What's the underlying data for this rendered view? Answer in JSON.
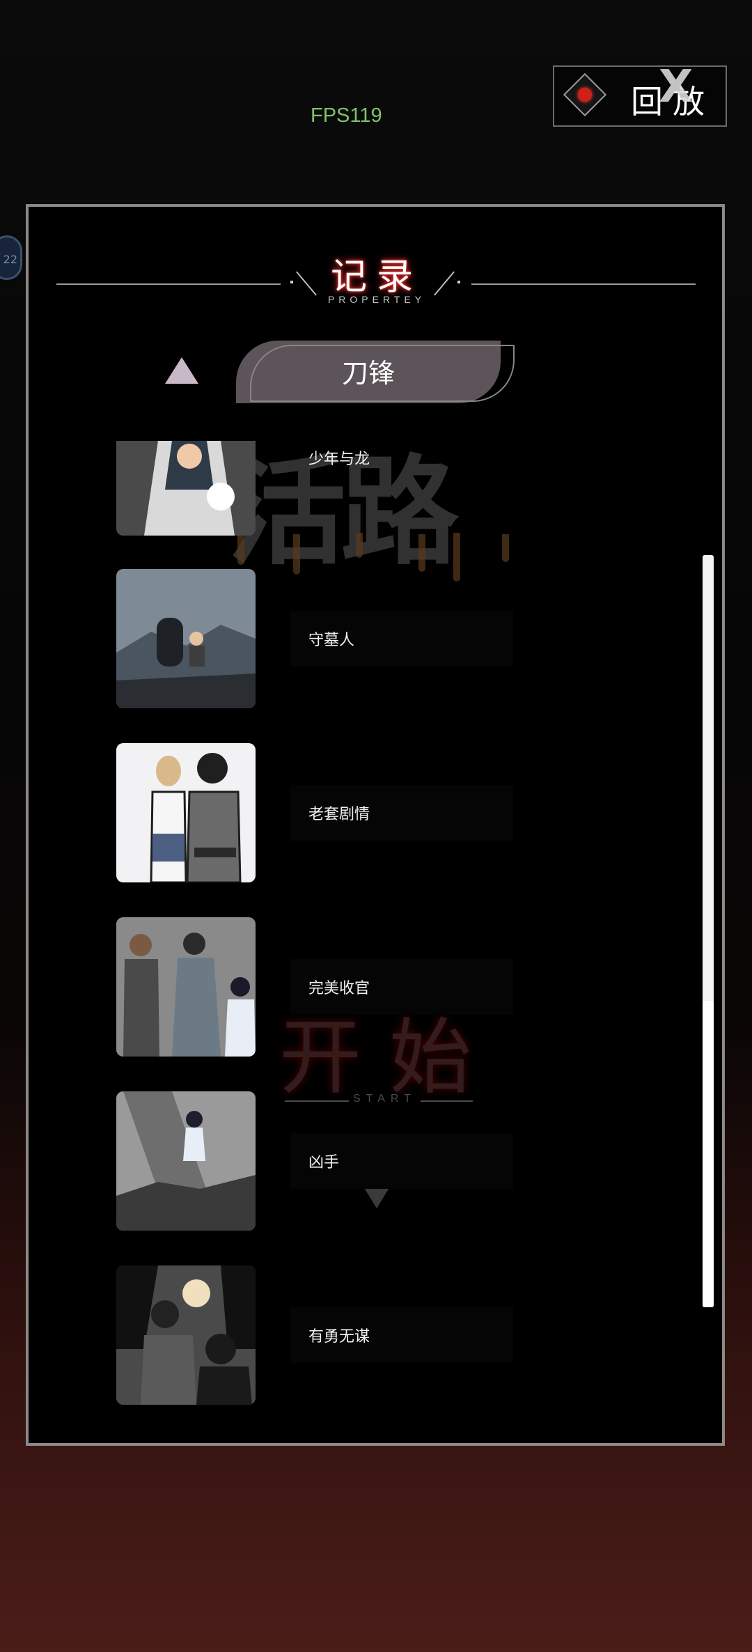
{
  "hud": {
    "fps": "FPS119",
    "side_badge": "22"
  },
  "replay": {
    "label": "回放",
    "close_glyph": "X"
  },
  "header": {
    "title": "记录",
    "subtitle": "PROPERTEY"
  },
  "tab": {
    "label": "刀锋"
  },
  "background_text": {
    "deco": "活路",
    "start": "开始",
    "start_sub": "START"
  },
  "records": [
    {
      "title": "少年与龙",
      "thumb": "hooded-figure-dragon-icon"
    },
    {
      "title": "守墓人",
      "thumb": "graveyard-rain-icon"
    },
    {
      "title": "老套剧情",
      "thumb": "couple-back-view-icon"
    },
    {
      "title": "完美收官",
      "thumb": "group-walking-icon"
    },
    {
      "title": "凶手",
      "thumb": "girl-on-rubble-icon"
    },
    {
      "title": "有勇无谋",
      "thumb": "surrounded-by-hoods-icon"
    }
  ],
  "colors": {
    "fps": "#7fc36b",
    "accent_red": "#d0201a",
    "panel_border": "#8d8886",
    "tab_bg": "#5c5459"
  }
}
